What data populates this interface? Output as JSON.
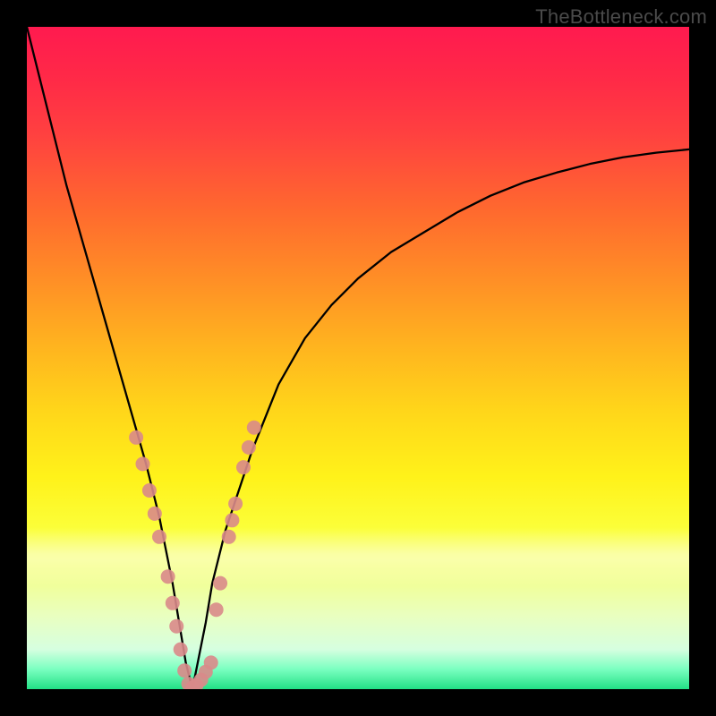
{
  "watermark": {
    "text": "TheBottleneck.com"
  },
  "chart_data": {
    "type": "line",
    "title": "",
    "xlabel": "",
    "ylabel": "",
    "xlim": [
      0,
      100
    ],
    "ylim": [
      0,
      100
    ],
    "grid": false,
    "legend": false,
    "series": [
      {
        "name": "bottleneck-curve",
        "x": [
          0,
          2,
          4,
          6,
          8,
          10,
          12,
          14,
          16,
          18,
          20,
          21,
          22,
          23,
          24,
          25,
          26,
          27,
          28,
          30,
          32,
          34,
          36,
          38,
          42,
          46,
          50,
          55,
          60,
          65,
          70,
          75,
          80,
          85,
          90,
          95,
          100
        ],
        "y": [
          100,
          92,
          84,
          76,
          69,
          62,
          55,
          48,
          41,
          34,
          26,
          21,
          16,
          10,
          4,
          0,
          5,
          10,
          16,
          24,
          30,
          36,
          41,
          46,
          53,
          58,
          62,
          66,
          69,
          72,
          74.5,
          76.5,
          78,
          79.3,
          80.3,
          81,
          81.5
        ],
        "color": "#000000",
        "width": 2.3
      }
    ],
    "markers": [
      {
        "name": "left-branch-cluster",
        "color": "#d98a8a",
        "radius": 8,
        "points": [
          {
            "x": 16.5,
            "y": 38
          },
          {
            "x": 17.5,
            "y": 34
          },
          {
            "x": 18.5,
            "y": 30
          },
          {
            "x": 19.3,
            "y": 26.5
          },
          {
            "x": 20.0,
            "y": 23
          },
          {
            "x": 21.3,
            "y": 17
          },
          {
            "x": 22.0,
            "y": 13
          },
          {
            "x": 22.6,
            "y": 9.5
          },
          {
            "x": 23.2,
            "y": 6
          },
          {
            "x": 23.8,
            "y": 2.8
          }
        ]
      },
      {
        "name": "valley-cluster",
        "color": "#d98a8a",
        "radius": 8,
        "points": [
          {
            "x": 24.4,
            "y": 0.8
          },
          {
            "x": 25.0,
            "y": 0.2
          },
          {
            "x": 25.6,
            "y": 0.6
          },
          {
            "x": 26.3,
            "y": 1.4
          },
          {
            "x": 27.0,
            "y": 2.6
          },
          {
            "x": 27.8,
            "y": 4.0
          }
        ]
      },
      {
        "name": "right-branch-cluster",
        "color": "#d98a8a",
        "radius": 8,
        "points": [
          {
            "x": 28.6,
            "y": 12
          },
          {
            "x": 29.2,
            "y": 16
          },
          {
            "x": 30.5,
            "y": 23
          },
          {
            "x": 31.0,
            "y": 25.5
          },
          {
            "x": 31.5,
            "y": 28
          },
          {
            "x": 32.7,
            "y": 33.5
          },
          {
            "x": 33.5,
            "y": 36.5
          },
          {
            "x": 34.3,
            "y": 39.5
          }
        ]
      }
    ]
  }
}
